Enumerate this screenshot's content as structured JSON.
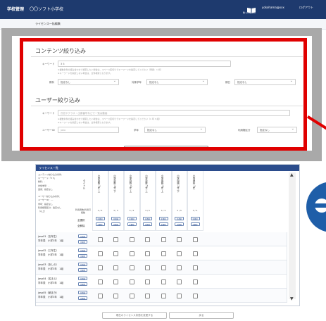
{
  "header": {
    "app_title": "学校管理",
    "school_name": "〇〇ソフト小学校",
    "book_label": "教っとしいた",
    "user_label": "yokohama@xxx",
    "logout_label": "ログアウト"
  },
  "breadcrumb": "ライセンス一括編集",
  "content_filter": {
    "title": "コンテンツ絞り込み",
    "keyword_label": "キーワード",
    "keyword_value": "3 5",
    "note1": "※複数条件の組み合わせで検索したい場合は、スペース区切りでキーワードを指定してください（登録：1 桁）",
    "note2": "※キーワードを指定しない場合は、全件検索となります。",
    "subject_label": "教科",
    "subject_value": "指定なし",
    "grade_label": "対象学年",
    "grade_value": "指定なし",
    "term_label": "期日",
    "term_value": "指定なし"
  },
  "user_filter": {
    "title": "ユーザー絞り込み",
    "keyword_label": "キーワード",
    "keyword_placeholder": "氏名やクラス・出席番号などで一覧は動画",
    "note1": "※複数条件の組み合わせで検索したい場合は、スペース区切りでキーワードを指定してください（1 年 3 組）",
    "note2": "※キーワードを指定しない場合は、全件検索となります。",
    "userid_label": "ユーザーID",
    "userid_placeholder": "jako",
    "grade_label": "学年",
    "grade_value": "指定なし",
    "license_label": "利用権区分",
    "license_value": "指定なし"
  },
  "license_panel": {
    "title": "ライセンス一覧",
    "conditions": [
      "コンテンツ絞り込み条件：",
      "キーワード「3 5」",
      "教科：-",
      "対象学年：-",
      "運用：指定なし",
      "",
      "ユーザー絞り込み条件：",
      "ユーザーID：---",
      "学年：指定なし",
      "利用権限区分：指定なし",
      "（以上）"
    ],
    "title_col_label": "タイトル",
    "grant_label": "利用者数/利用可能数",
    "all_select_label": "全選択",
    "all_release_label": "全解除",
    "columns": [
      {
        "title": "小学算数 3年 上",
        "counts": "3 / 5"
      },
      {
        "title": "小学算数 3年 下",
        "counts": "3 / 5"
      },
      {
        "title": "小学算数 4年 上",
        "counts": "3 / 5"
      },
      {
        "title": "小学算数 5年 上",
        "counts": "3 / 5"
      },
      {
        "title": "小学国語 3年 上",
        "counts": "3 / 5"
      },
      {
        "title": "小学国語 3年 下",
        "counts": "3 / 5"
      },
      {
        "title": "小学理科 3年",
        "counts": "3 / 5"
      }
    ],
    "mini_all": "全選択",
    "mini_clear": "全解除",
    "rows": [
      {
        "name": "jaso01（五年生）",
        "class": "学年表　小学3年　1組"
      },
      {
        "name": "jaso02（三年生）",
        "class": "学年表　小学3年　1組"
      },
      {
        "name": "jaso03（あしの）",
        "class": "学年表　小学3年　1組"
      },
      {
        "name": "jaso04（名まえ）",
        "class": "学年表　小学3年　1組"
      },
      {
        "name": "jaso05（朝まき）",
        "class": "学年表　小学3年　1組"
      }
    ]
  },
  "footer": {
    "save_label": "現在のライセンス状態を変更する",
    "back_label": "戻る"
  }
}
